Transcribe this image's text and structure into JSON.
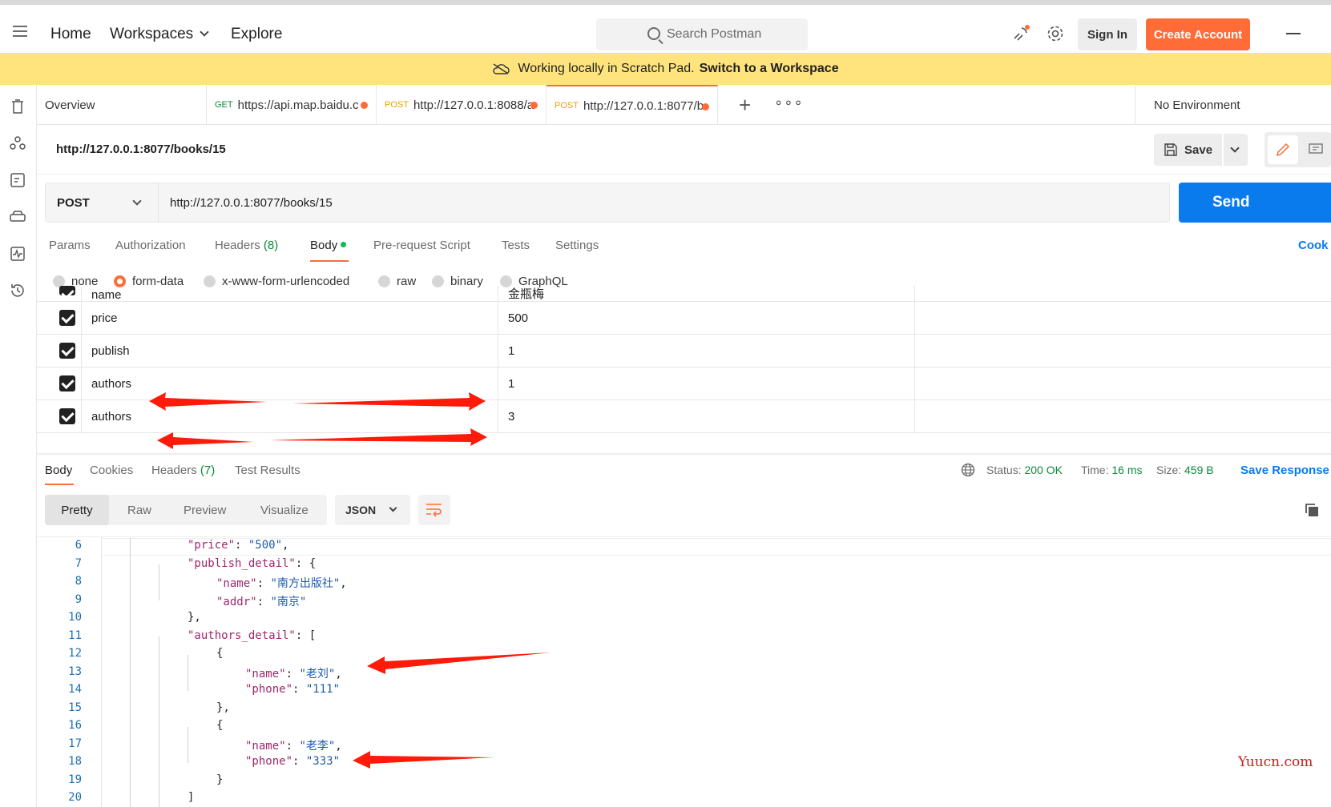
{
  "topnav": {
    "home": "Home",
    "workspaces": "Workspaces",
    "explore": "Explore",
    "search_placeholder": "Search Postman",
    "sign_in": "Sign In",
    "create_account": "Create Account",
    "accent": "#ff6c37"
  },
  "banner": {
    "text": "Working locally in Scratch Pad.",
    "link": "Switch to a Workspace"
  },
  "tabs": [
    {
      "label": "Overview"
    },
    {
      "method": "GET",
      "label": "https://api.map.baidu.c"
    },
    {
      "method": "POST",
      "label": "http://127.0.0.1:8088/a"
    },
    {
      "method": "POST",
      "label": "http://127.0.0.1:8077/b"
    }
  ],
  "environment": "No Environment",
  "request": {
    "title": "http://127.0.0.1:8077/books/15",
    "save": "Save",
    "method": "POST",
    "url": "http://127.0.0.1:8077/books/15",
    "send": "Send"
  },
  "request_tabs": {
    "params": "Params",
    "authorization": "Authorization",
    "headers": "Headers",
    "headers_count": "(8)",
    "body": "Body",
    "prerequest": "Pre-request Script",
    "tests": "Tests",
    "settings": "Settings",
    "cookies": "Cook"
  },
  "body_types": {
    "none": "none",
    "form_data": "form-data",
    "urlencoded": "x-www-form-urlencoded",
    "raw": "raw",
    "binary": "binary",
    "graphql": "GraphQL",
    "selected": "form-data"
  },
  "form_rows": [
    {
      "key": "name",
      "value": "金瓶梅"
    },
    {
      "key": "price",
      "value": "500"
    },
    {
      "key": "publish",
      "value": "1"
    },
    {
      "key": "authors",
      "value": "1"
    },
    {
      "key": "authors",
      "value": "3"
    }
  ],
  "response_tabs": {
    "body": "Body",
    "cookies": "Cookies",
    "headers": "Headers",
    "headers_count": "(7)",
    "test_results": "Test Results"
  },
  "response_status": {
    "status_label": "Status:",
    "status": "200 OK",
    "time_label": "Time:",
    "time": "16 ms",
    "size_label": "Size:",
    "size": "459 B",
    "save_response": "Save Response"
  },
  "view_modes": {
    "pretty": "Pretty",
    "raw": "Raw",
    "preview": "Preview",
    "visualize": "Visualize",
    "format": "JSON"
  },
  "code_lines": [
    {
      "n": "6",
      "t": "\"price\": \"500\","
    },
    {
      "n": "7",
      "t": "\"publish_detail\": {"
    },
    {
      "n": "8",
      "t": "\"name\": \"南方出版社\","
    },
    {
      "n": "9",
      "t": "\"addr\": \"南京\""
    },
    {
      "n": "10",
      "t": "},"
    },
    {
      "n": "11",
      "t": "\"authors_detail\": ["
    },
    {
      "n": "12",
      "t": "{"
    },
    {
      "n": "13",
      "t": "\"name\": \"老刘\","
    },
    {
      "n": "14",
      "t": "\"phone\": \"111\""
    },
    {
      "n": "15",
      "t": "},"
    },
    {
      "n": "16",
      "t": "{"
    },
    {
      "n": "17",
      "t": "\"name\": \"老李\","
    },
    {
      "n": "18",
      "t": "\"phone\": \"333\""
    },
    {
      "n": "19",
      "t": "}"
    },
    {
      "n": "20",
      "t": "]"
    }
  ],
  "watermark": "Yuucn.com"
}
